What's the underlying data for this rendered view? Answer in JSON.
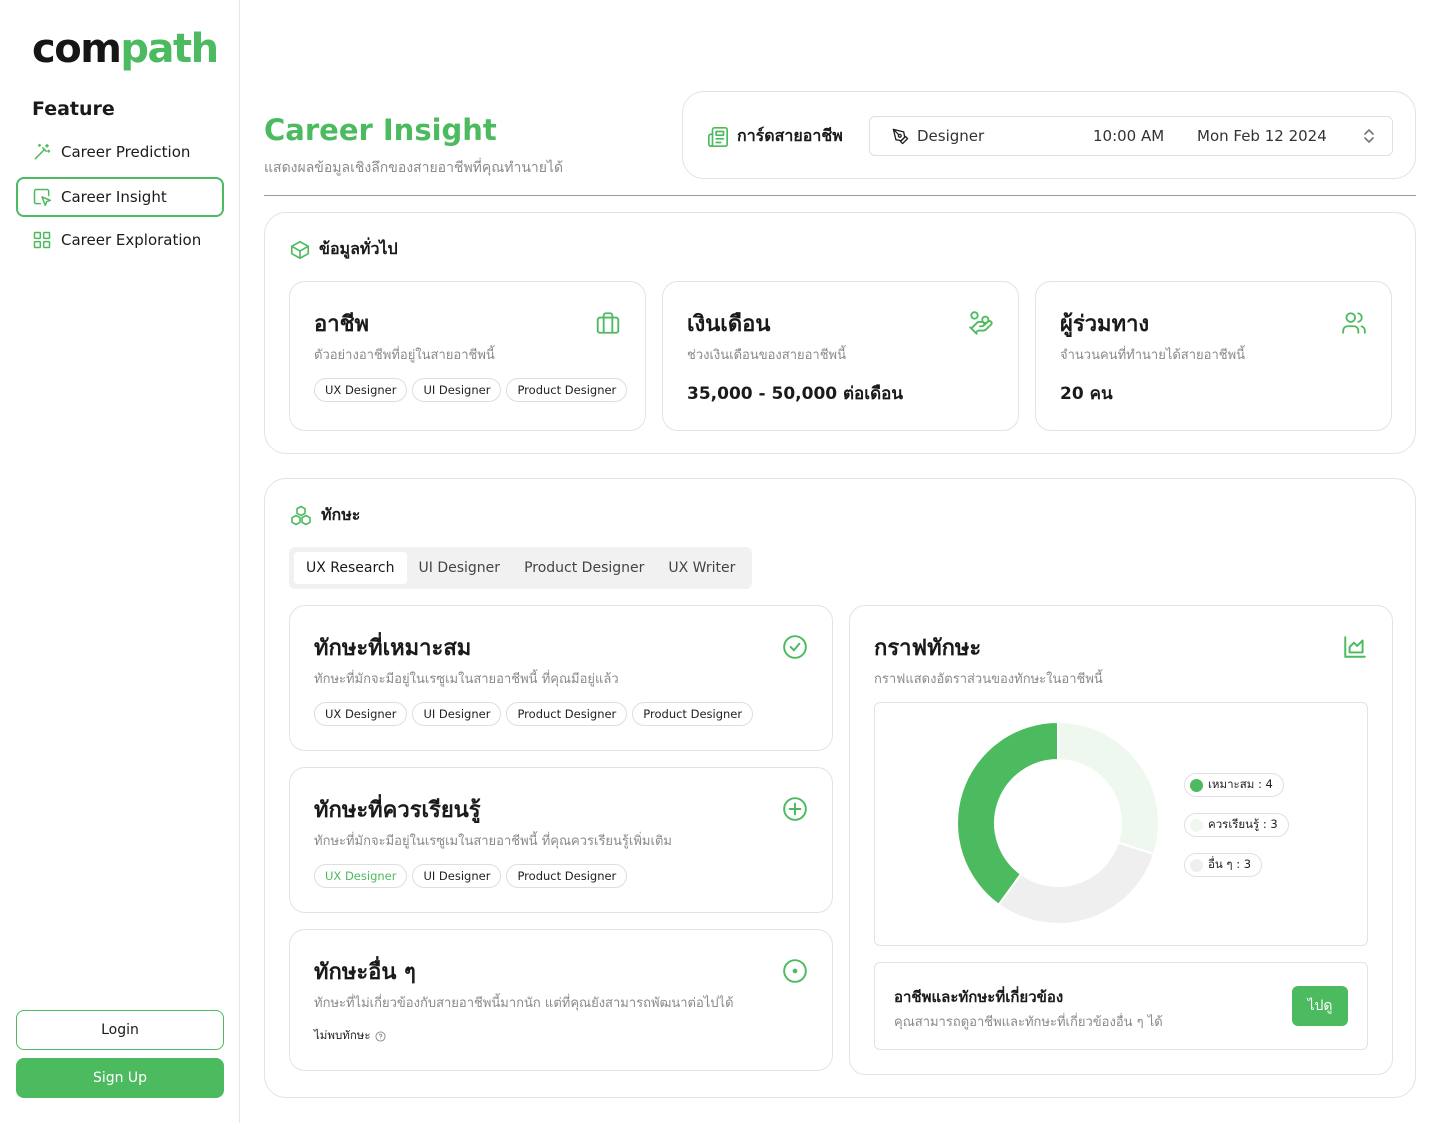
{
  "brand": {
    "part1": "com",
    "part2": "path"
  },
  "sidebar": {
    "section_title": "Feature",
    "items": [
      {
        "label": "Career Prediction",
        "icon": "magic-wand-icon"
      },
      {
        "label": "Career Insight",
        "icon": "cursor-box-icon",
        "active": true
      },
      {
        "label": "Career Exploration",
        "icon": "grid-icon"
      }
    ],
    "login_label": "Login",
    "signup_label": "Sign Up"
  },
  "header": {
    "title": "Career Insight",
    "subtitle": "แสดงผลข้อมูลเชิงลึกของสายอาชีพที่คุณทำนายได้",
    "career_card_label": "การ์ดสายอาชีพ",
    "selected": {
      "role": "Designer",
      "time": "10:00 AM",
      "date": "Mon Feb 12 2024"
    }
  },
  "general": {
    "title": "ข้อมูลทั่วไป",
    "career": {
      "title": "อาชีพ",
      "subtitle": "ตัวอย่างอาชีพที่อยู่ในสายอาชีพนี้",
      "tags": [
        "UX Designer",
        "UI Designer",
        "Product Designer"
      ]
    },
    "salary": {
      "title": "เงินเดือน",
      "subtitle": "ช่วงเงินเดือนของสายอาชีพนี้",
      "value": "35,000 - 50,000 ต่อเดือน"
    },
    "peers": {
      "title": "ผู้ร่วมทาง",
      "subtitle": "จำนวนคนที่ทำนายได้สายอาชีพนี้",
      "value": "20 คน"
    }
  },
  "skills": {
    "title": "ทักษะ",
    "tabs": [
      "UX Research",
      "UI Designer",
      "Product Designer",
      "UX Writer"
    ],
    "active_tab": 0,
    "suitable": {
      "title": "ทักษะที่เหมาะสม",
      "subtitle": "ทักษะที่มักจะมีอยู่ในเรซูเมในสายอาชีพนี้ ที่คุณมีอยู่แล้ว",
      "tags": [
        "UX Designer",
        "UI Designer",
        "Product Designer",
        "Product Designer"
      ]
    },
    "should_learn": {
      "title": "ทักษะที่ควรเรียนรู้",
      "subtitle": "ทักษะที่มักจะมีอยู่ในเรซูเมในสายอาชีพนี้  ที่คุณควรเรียนรู้เพิ่มเติม",
      "tags": [
        "UX Designer",
        "UI Designer",
        "Product Designer"
      ]
    },
    "other": {
      "title": "ทักษะอื่น ๆ",
      "subtitle": "ทักษะที่ไม่เกี่ยวข้องกับสายอาชีพนี้มากนัก แต่ที่คุณยังสามารถพัฒนาต่อไปได้",
      "empty_label": "ไม่พบทักษะ"
    },
    "graph": {
      "title": "กราฟทักษะ",
      "subtitle": "กราฟแสดงอัตราส่วนของทักษะในอาชีพนี้"
    },
    "related": {
      "title": "อาชีพและทักษะที่เกี่ยวข้อง",
      "subtitle": "คุณสามารถดูอาชีพและทักษะที่เกี่ยวข้องอื่น ๆ ได้",
      "button_label": "ไปดู"
    }
  },
  "chart_data": {
    "type": "pie",
    "categories": [
      "เหมาะสม",
      "ควรเรียนรู้",
      "อื่น ๆ"
    ],
    "values": [
      4,
      3,
      3
    ],
    "legend_labels": [
      "เหมาะสม : 4",
      "ควรเรียนรู้ : 3",
      "อื่น ๆ : 3"
    ],
    "colors": [
      "#4cba5f",
      "#eef8ef",
      "#efefef"
    ],
    "donut": true,
    "legend_position": "right"
  },
  "colors": {
    "accent": "#4cba5f",
    "border": "#e3e3e3",
    "muted_text": "#8a8a8a"
  }
}
